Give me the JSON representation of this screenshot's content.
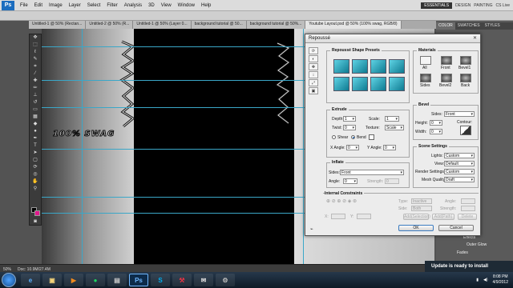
{
  "menubar": {
    "app_logo": "Ps",
    "items": [
      "File",
      "Edit",
      "Image",
      "Layer",
      "Select",
      "Filter",
      "Analysis",
      "3D",
      "View",
      "Window",
      "Help"
    ],
    "workspace": {
      "active": "ESSENTIALS",
      "design": "DESIGN",
      "painting": "PAINTING",
      "cs_live": "CS Live"
    }
  },
  "doc_tabs": [
    "Untitled-1 @ 50% (Rectan...",
    "Untitled-2 @ 50% (R...",
    "Untitled-1 @ 50% (Layer 0...",
    "background tutorial @ 50...",
    "background tutorial @ 50%...",
    "Youtube Layout.psd @ 50% (100% swag, RGB/8)"
  ],
  "canvas": {
    "swag_text": "100% SWAG"
  },
  "status": {
    "zoom": "50%",
    "doc": "Doc: 10.9M/27.4M"
  },
  "right_panel": {
    "tabs": [
      "COLOR",
      "SWATCHES",
      "STYLES"
    ],
    "layers": [
      "Effects",
      "Outer Glow",
      "Fades"
    ]
  },
  "update_notice": "Update is ready to install",
  "dialog": {
    "title": "Repoussé",
    "shape_presets_title": "Repoussé Shape Presets",
    "materials_title": "Materials",
    "materials": [
      "All",
      "Front",
      "Bevel1",
      "Sides",
      "Bevel2",
      "Back"
    ],
    "extrude": {
      "title": "Extrude",
      "depth_label": "Depth:",
      "depth": "1",
      "scale_label": "Scale:",
      "scale": "1",
      "twist_label": "Twist:",
      "twist": "0",
      "texture_label": "Texture:",
      "texture": "Scale",
      "shear_label": "Shear",
      "bend_label": "Bend",
      "xangle_label": "X Angle:",
      "xangle": "0",
      "yangle_label": "Y Angle:",
      "yangle": "0"
    },
    "bevel": {
      "title": "Bevel",
      "sides_label": "Sides:",
      "sides": "Front",
      "height_label": "Height:",
      "height": "0",
      "width_label": "Width:",
      "width": "0",
      "contour_label": "Contour:"
    },
    "inflate": {
      "title": "Inflate",
      "sides_label": "Sides:",
      "sides": "Front",
      "angle_label": "Angle:",
      "angle": "0",
      "strength_label": "Strength:",
      "strength": "0"
    },
    "scene": {
      "title": "Scene Settings",
      "lights_label": "Lights:",
      "lights": "Custom",
      "view_label": "View:",
      "view": "Default",
      "render_label": "Render Settings:",
      "render": "Custom",
      "mesh_label": "Mesh Quality:",
      "mesh": "Draft"
    },
    "constraints": {
      "title": "Internal Constraints",
      "type_label": "Type:",
      "type": "Inactive",
      "side_label": "Side:",
      "side": "Both",
      "angle_label": "Angle:",
      "angle": "",
      "strength_label": "Strength:",
      "strength": "",
      "x_label": "X:",
      "y_label": "Y:",
      "add_selection": "Add(Selection)",
      "add_path": "Add(Path)",
      "delete": "Delete"
    },
    "ok": "OK",
    "cancel": "Cancel"
  },
  "taskbar": {
    "apps": [
      "e",
      "▣",
      "▶",
      "●",
      "▤",
      "Ps",
      "S",
      "⚒",
      "✉",
      "⚙"
    ],
    "time": "8:08 PM",
    "date": "4/9/2012"
  }
}
